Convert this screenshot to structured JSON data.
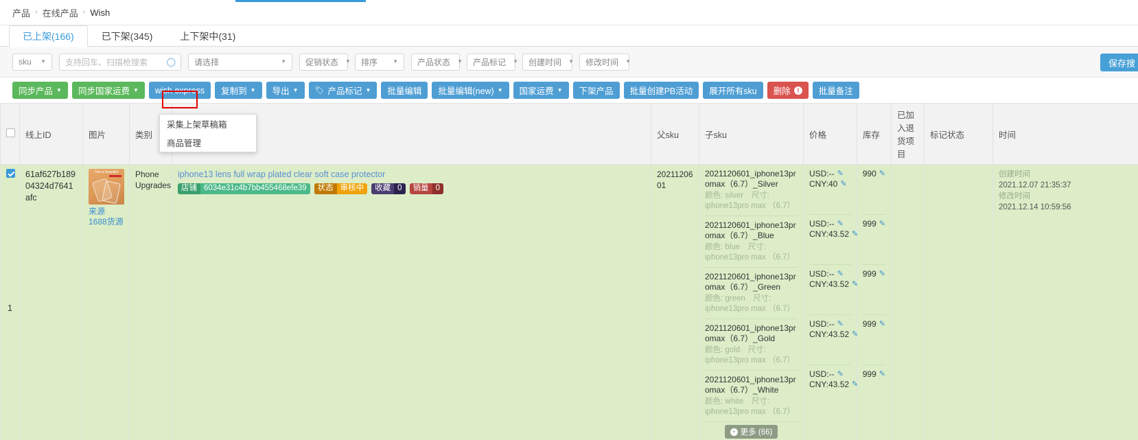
{
  "theme": {
    "accent": "#3a9ad9",
    "row_bg": "#dcedc8",
    "highlight_box": "#e60000"
  },
  "breadcrumb": {
    "items": [
      "产品",
      "在线产品",
      "Wish"
    ],
    "separator": "›"
  },
  "tabs": [
    {
      "label": "已上架(166)",
      "active": true
    },
    {
      "label": "已下架(345)",
      "active": false
    },
    {
      "label": "上下架中(31)",
      "active": false
    }
  ],
  "filters": {
    "sku_select": "sku",
    "search_placeholder": "支持回车、扫描枪搜索",
    "search_value": "",
    "select_placeholder": "请选择",
    "promo_status": "促销状态",
    "sort": "排序",
    "product_status": "产品状态",
    "product_tag": "产品标记",
    "create_time": "创建时间",
    "modify_time": "修改时间",
    "save_search": "保存搜"
  },
  "toolbar": [
    {
      "label": "同步产品",
      "color": "green",
      "caret": true
    },
    {
      "label": "同步国家运费",
      "color": "green",
      "caret": true
    },
    {
      "label": "wish express",
      "color": "blue",
      "caret": false,
      "plain": true
    },
    {
      "label": "复制到",
      "color": "blue",
      "caret": true,
      "highlighted": true
    },
    {
      "label": "导出",
      "color": "blue",
      "caret": true
    },
    {
      "label": "产品标记",
      "color": "blue",
      "caret": true,
      "tagicon": true
    },
    {
      "label": "批量编辑",
      "color": "blue",
      "caret": false
    },
    {
      "label": "批量编辑(new)",
      "color": "blue",
      "caret": true
    },
    {
      "label": "国家运费",
      "color": "blue",
      "caret": true
    },
    {
      "label": "下架产品",
      "color": "blue",
      "caret": false
    },
    {
      "label": "批量创建PB活动",
      "color": "blue",
      "caret": false
    },
    {
      "label": "展开所有sku",
      "color": "blue",
      "caret": false
    },
    {
      "label": "删除",
      "color": "red",
      "caret": false,
      "warn": "!"
    },
    {
      "label": "批量备注",
      "color": "blue",
      "caret": false
    }
  ],
  "dropdown": {
    "open": true,
    "items": [
      {
        "label": "采集上架草稿箱",
        "highlighted": false
      },
      {
        "label": "商品管理",
        "highlighted": true
      }
    ]
  },
  "table": {
    "headers": [
      "",
      "线上ID",
      "图片",
      "类别",
      "",
      "父sku",
      "子sku",
      "价格",
      "库存",
      "已加入退货项目",
      "标记状态",
      "时间"
    ],
    "row": {
      "selected": true,
      "row_number": "1",
      "online_id": "61af627b18904324d7641afc",
      "image_caption": "来源",
      "image_source": "1688货源",
      "image_banner_text": "This is beautiful",
      "category": "Phone Upgrades",
      "product_title": "iphone13 lens full wrap plated clear soft case protector",
      "badges": [
        {
          "key": "店铺",
          "value": "6034e31c4b7bb455468efe39",
          "style": "b-shop"
        },
        {
          "key": "状态",
          "value": "审核中",
          "style": "b-state"
        },
        {
          "key": "收藏",
          "value": "0",
          "style": "b-fav"
        },
        {
          "key": "销量",
          "value": "0",
          "style": "b-sales"
        }
      ],
      "parent_sku": "2021120601",
      "skus": [
        {
          "name": "2021120601_iphone13promax（6.7）_Silver",
          "attrs": "颜色: silver　尺寸: iphone13pro max （6.7）",
          "price_usd": "USD:--",
          "price_cny": "CNY:40",
          "stock": "990"
        },
        {
          "name": "2021120601_iphone13promax（6.7）_Blue",
          "attrs": "颜色: blue　尺寸: iphone13pro max （6.7）",
          "price_usd": "USD:--",
          "price_cny": "CNY:43.52",
          "stock": "999"
        },
        {
          "name": "2021120601_iphone13promax（6.7）_Green",
          "attrs": "颜色: green　尺寸: iphone13pro max （6.7）",
          "price_usd": "USD:--",
          "price_cny": "CNY:43.52",
          "stock": "999"
        },
        {
          "name": "2021120601_iphone13promax（6.7）_Gold",
          "attrs": "颜色: gold　尺寸: iphone13pro max （6.7）",
          "price_usd": "USD:--",
          "price_cny": "CNY:43.52",
          "stock": "999"
        },
        {
          "name": "2021120601_iphone13promax（6.7）_White",
          "attrs": "颜色: white　尺寸: iphone13pro max （6.7）",
          "price_usd": "USD:--",
          "price_cny": "CNY:43.52",
          "stock": "999"
        }
      ],
      "more_label": "更多 (66)",
      "return_project": "",
      "tag_status": "",
      "time": {
        "create_label": "创建时间",
        "create_value": "2021.12.07 21:35:37",
        "modify_label": "修改时间",
        "modify_value": "2021.12.14 10:59:56"
      }
    }
  }
}
